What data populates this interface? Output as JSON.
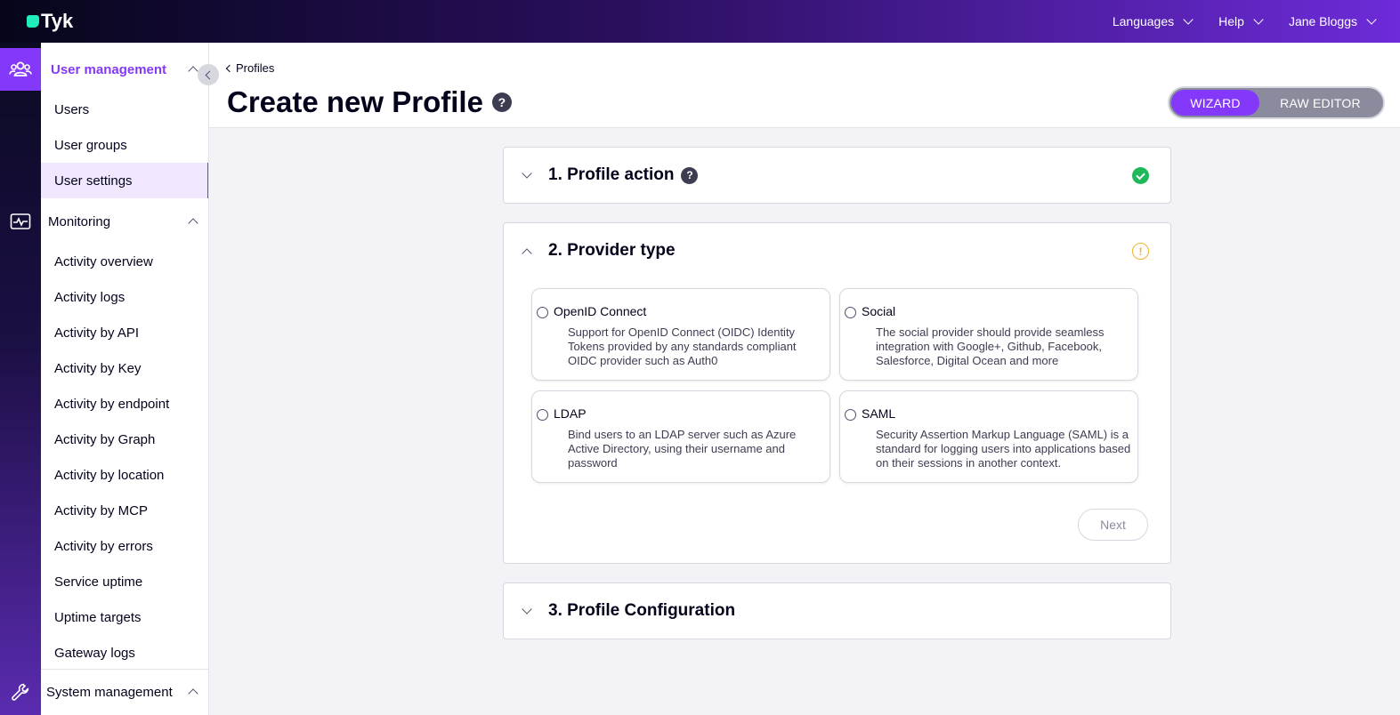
{
  "topbar": {
    "logo_text": "Tyk",
    "nav": [
      {
        "label": "Languages"
      },
      {
        "label": "Help"
      },
      {
        "label": "Jane Bloggs"
      }
    ]
  },
  "rail": {
    "items": [
      {
        "icon": "users-icon",
        "active": true
      },
      {
        "icon": "monitoring-icon",
        "active": false
      },
      {
        "icon": "wrench-icon",
        "active": false
      }
    ]
  },
  "sidebar": {
    "user_management": {
      "title": "User management",
      "items": [
        {
          "label": "Users"
        },
        {
          "label": "User groups"
        },
        {
          "label": "User settings"
        }
      ]
    },
    "monitoring": {
      "title": "Monitoring",
      "items": [
        {
          "label": "Activity overview"
        },
        {
          "label": "Activity logs"
        },
        {
          "label": "Activity by API"
        },
        {
          "label": "Activity by Key"
        },
        {
          "label": "Activity by endpoint"
        },
        {
          "label": "Activity by Graph"
        },
        {
          "label": "Activity by location"
        },
        {
          "label": "Activity by MCP"
        },
        {
          "label": "Activity by errors"
        },
        {
          "label": "Service uptime"
        },
        {
          "label": "Uptime targets"
        },
        {
          "label": "Gateway logs"
        }
      ]
    },
    "system_management": {
      "title": "System management"
    }
  },
  "header": {
    "breadcrumb": "Profiles",
    "title": "Create new Profile",
    "help": "?",
    "toggle": {
      "wizard": "WIZARD",
      "raw": "RAW EDITOR"
    }
  },
  "steps": {
    "step1": {
      "title": "1. Profile action",
      "help": "?",
      "status": "complete"
    },
    "step2": {
      "title": "2. Provider type",
      "status": "warning",
      "warn_symbol": "!",
      "options": [
        {
          "title": "OpenID Connect",
          "desc": "Support for OpenID Connect (OIDC) Identity Tokens provided by any standards compliant OIDC provider such as Auth0"
        },
        {
          "title": "Social",
          "desc": "The social provider should provide seamless integration with Google+, Github, Facebook, Salesforce, Digital Ocean and more"
        },
        {
          "title": "LDAP",
          "desc": "Bind users to an LDAP server such as Azure Active Directory, using their username and password"
        },
        {
          "title": "SAML",
          "desc": "Security Assertion Markup Language (SAML) is a standard for logging users into applications based on their sessions in another context."
        }
      ],
      "next_label": "Next"
    },
    "step3": {
      "title": "3. Profile Configuration"
    }
  },
  "colors": {
    "accent": "#8438fa",
    "success": "#1fb85a",
    "warning": "#f0b32c"
  }
}
